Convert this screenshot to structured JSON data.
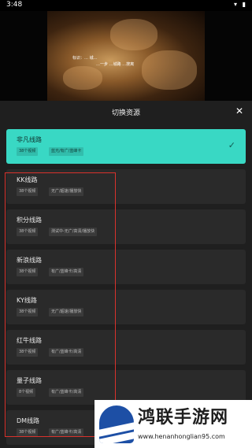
{
  "status": {
    "time": "3:48",
    "icons": "▾ ▮"
  },
  "video": {
    "subtitle_1": "标识：…  城…",
    "subtitle_2": "…一步 …城路 …搜离"
  },
  "panel": {
    "title": "切换资源",
    "close_label": "✕"
  },
  "lines": [
    {
      "name": "非凡线路",
      "count": "38个视频",
      "desc": "蓝光/有广/蓝峰卡",
      "selected": true
    },
    {
      "name": "KK线路",
      "count": "38个视频",
      "desc": "无广/超速/播放快",
      "selected": false
    },
    {
      "name": "积分线路",
      "count": "38个视频",
      "desc": "测试中-无广/高清/播放快",
      "selected": false
    },
    {
      "name": "新浪线路",
      "count": "38个视频",
      "desc": "有广/蓝峰卡/高清",
      "selected": false
    },
    {
      "name": "KY线路",
      "count": "38个视频",
      "desc": "无广/超速/播放快",
      "selected": false
    },
    {
      "name": "红牛线路",
      "count": "38个视频",
      "desc": "有广/蓝峰卡/高清",
      "selected": false
    },
    {
      "name": "量子线路",
      "count": "8个视频",
      "desc": "有广/蓝峰卡/高清",
      "selected": false
    },
    {
      "name": "DM线路",
      "count": "38个视频",
      "desc": "有广/蓝峰卡/高清",
      "selected": false
    }
  ],
  "watermark": {
    "title": "鸿联手游网",
    "url": "www.henanhonglian95.com"
  },
  "colors": {
    "accent": "#39d8c4",
    "highlight": "#d9322c",
    "panel": "#1f1f1f",
    "card": "#2a2a2a"
  }
}
